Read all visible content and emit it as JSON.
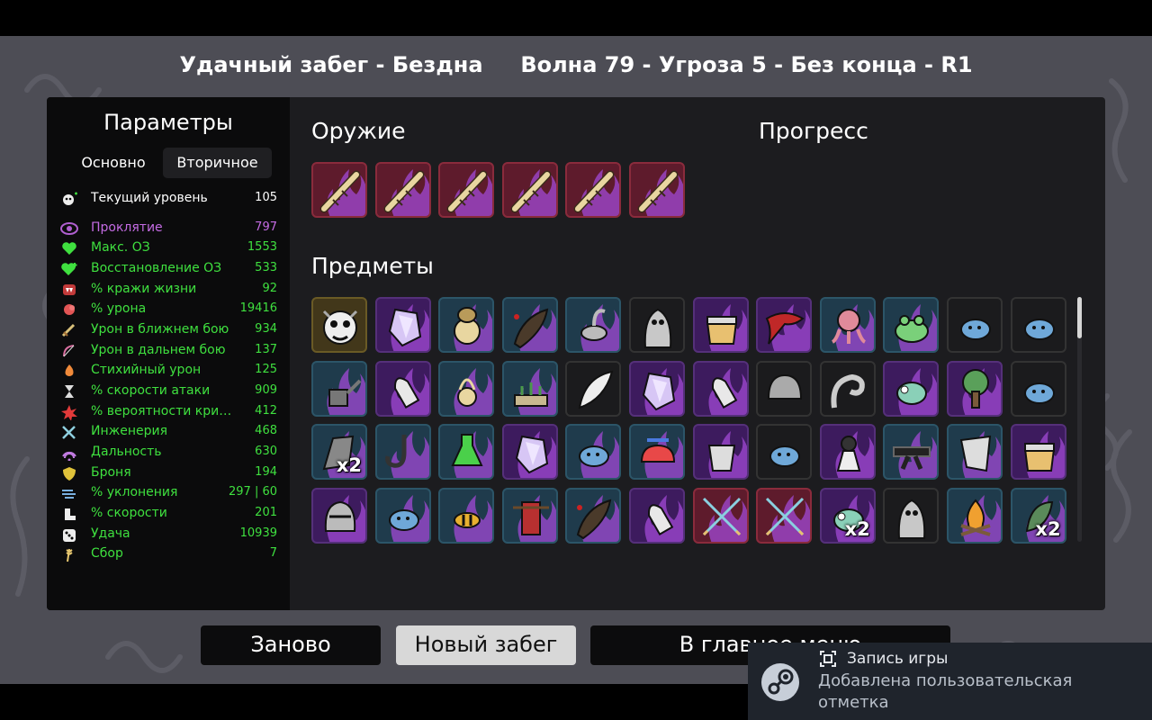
{
  "header": {
    "run_result": "Удачный забег - Бездна",
    "wave_info": "Волна 79 - Угроза 5 - Без конца - R1"
  },
  "params": {
    "title": "Параметры",
    "tabs": [
      "Основно",
      "Вторичное"
    ],
    "active_tab": "Вторичное",
    "stats": [
      {
        "label": "Текущий уровень",
        "value": "105",
        "color": "#ffffff",
        "icon": "level-icon"
      },
      {
        "label": "Проклятие",
        "value": "797",
        "color": "#c46be3",
        "icon": "curse-eye-icon"
      },
      {
        "label": "Макс. ОЗ",
        "value": "1553",
        "color": "#3fe03f",
        "icon": "heart-icon"
      },
      {
        "label": "Восстановление ОЗ",
        "value": "533",
        "color": "#3fe03f",
        "icon": "heart-regen-icon"
      },
      {
        "label": "% кражи жизни",
        "value": "92",
        "color": "#3fe03f",
        "icon": "lifesteal-fangs-icon"
      },
      {
        "label": "% урона",
        "value": "19416",
        "color": "#3fe03f",
        "icon": "damage-muscle-icon"
      },
      {
        "label": "Урон в ближнем бою",
        "value": "934",
        "color": "#3fe03f",
        "icon": "melee-sword-icon"
      },
      {
        "label": "Урон в дальнем бою",
        "value": "137",
        "color": "#3fe03f",
        "icon": "ranged-bow-icon"
      },
      {
        "label": "Стихийный урон",
        "value": "125",
        "color": "#3fe03f",
        "icon": "elemental-flame-icon"
      },
      {
        "label": "% скорости атаки",
        "value": "909",
        "color": "#3fe03f",
        "icon": "hourglass-icon"
      },
      {
        "label": "% вероятности крит. у...",
        "value": "412",
        "color": "#3fe03f",
        "icon": "crit-burst-icon"
      },
      {
        "label": "Инженерия",
        "value": "468",
        "color": "#3fe03f",
        "icon": "engineering-wrench-icon"
      },
      {
        "label": "Дальность",
        "value": "630",
        "color": "#3fe03f",
        "icon": "range-waves-icon"
      },
      {
        "label": "Броня",
        "value": "194",
        "color": "#3fe03f",
        "icon": "armor-shield-icon"
      },
      {
        "label": "% уклонения",
        "value": "297 | 60",
        "color": "#3fe03f",
        "icon": "dodge-wind-icon"
      },
      {
        "label": "% скорости",
        "value": "201",
        "color": "#3fe03f",
        "icon": "speed-boot-icon"
      },
      {
        "label": "Удача",
        "value": "10939",
        "color": "#3fe03f",
        "icon": "luck-dice-icon"
      },
      {
        "label": "Сбор",
        "value": "7",
        "color": "#3fe03f",
        "icon": "harvest-wheat-icon"
      }
    ]
  },
  "weapons": {
    "title": "Оружие",
    "items": [
      {
        "icon": "stick-weapon-icon",
        "tier": "legendary"
      },
      {
        "icon": "stick-weapon-icon",
        "tier": "legendary"
      },
      {
        "icon": "stick-weapon-icon",
        "tier": "legendary"
      },
      {
        "icon": "stick-weapon-icon",
        "tier": "legendary"
      },
      {
        "icon": "stick-weapon-icon",
        "tier": "legendary"
      },
      {
        "icon": "stick-weapon-icon",
        "tier": "legendary"
      }
    ]
  },
  "progress": {
    "title": "Прогресс"
  },
  "items": {
    "title": "Предметы",
    "list": [
      {
        "icon": "skull-mask-icon",
        "tier": "special",
        "count": ""
      },
      {
        "icon": "crystal-icon",
        "tier": "rare",
        "count": ""
      },
      {
        "icon": "compact-mirror-icon",
        "tier": "uncommon",
        "count": ""
      },
      {
        "icon": "leech-icon",
        "tier": "uncommon",
        "count": ""
      },
      {
        "icon": "scorpion-icon",
        "tier": "uncommon",
        "count": ""
      },
      {
        "icon": "ghost-statue-icon",
        "tier": "common",
        "count": ""
      },
      {
        "icon": "honey-jar-icon",
        "tier": "rare",
        "count": ""
      },
      {
        "icon": "red-scarf-icon",
        "tier": "rare",
        "count": ""
      },
      {
        "icon": "octopus-icon",
        "tier": "uncommon",
        "count": ""
      },
      {
        "icon": "frog-icon",
        "tier": "uncommon",
        "count": ""
      },
      {
        "icon": "blue-fish-icon",
        "tier": "common",
        "count": ""
      },
      {
        "icon": "blue-fish-icon",
        "tier": "common",
        "count": ""
      },
      {
        "icon": "watering-can-icon",
        "tier": "uncommon",
        "count": ""
      },
      {
        "icon": "bullet-icon",
        "tier": "rare",
        "count": ""
      },
      {
        "icon": "locket-icon",
        "tier": "uncommon",
        "count": ""
      },
      {
        "icon": "garden-bed-icon",
        "tier": "uncommon",
        "count": ""
      },
      {
        "icon": "feather-icon",
        "tier": "common",
        "count": ""
      },
      {
        "icon": "crystal-icon",
        "tier": "rare",
        "count": ""
      },
      {
        "icon": "bullet-icon",
        "tier": "rare",
        "count": ""
      },
      {
        "icon": "helmet-icon",
        "tier": "common",
        "count": ""
      },
      {
        "icon": "tentacle-icon",
        "tier": "common",
        "count": ""
      },
      {
        "icon": "chameleon-icon",
        "tier": "rare",
        "count": ""
      },
      {
        "icon": "tree-icon",
        "tier": "rare",
        "count": ""
      },
      {
        "icon": "blue-fish-icon",
        "tier": "common",
        "count": ""
      },
      {
        "icon": "stone-idol-icon",
        "tier": "uncommon",
        "count": "x2"
      },
      {
        "icon": "hook-icon",
        "tier": "uncommon",
        "count": ""
      },
      {
        "icon": "green-potion-icon",
        "tier": "uncommon",
        "count": ""
      },
      {
        "icon": "crystal-icon",
        "tier": "rare",
        "count": ""
      },
      {
        "icon": "blue-fish-icon",
        "tier": "uncommon",
        "count": ""
      },
      {
        "icon": "propeller-hat-icon",
        "tier": "uncommon",
        "count": ""
      },
      {
        "icon": "bucket-icon",
        "tier": "rare",
        "count": ""
      },
      {
        "icon": "blue-fish-icon",
        "tier": "common",
        "count": ""
      },
      {
        "icon": "maid-doll-icon",
        "tier": "rare",
        "count": ""
      },
      {
        "icon": "black-belt-icon",
        "tier": "uncommon",
        "count": ""
      },
      {
        "icon": "gauntlet-icon",
        "tier": "uncommon",
        "count": ""
      },
      {
        "icon": "honey-jar-icon",
        "tier": "rare",
        "count": ""
      },
      {
        "icon": "knight-helm-icon",
        "tier": "rare",
        "count": ""
      },
      {
        "icon": "blue-fish-icon",
        "tier": "uncommon",
        "count": ""
      },
      {
        "icon": "wasp-icon",
        "tier": "uncommon",
        "count": ""
      },
      {
        "icon": "scarecrow-icon",
        "tier": "uncommon",
        "count": ""
      },
      {
        "icon": "leech-icon",
        "tier": "uncommon",
        "count": ""
      },
      {
        "icon": "bullet-icon",
        "tier": "rare",
        "count": ""
      },
      {
        "icon": "crossed-arrows-icon",
        "tier": "legendary",
        "count": ""
      },
      {
        "icon": "crossed-arrows-icon",
        "tier": "legendary",
        "count": ""
      },
      {
        "icon": "chameleon-icon",
        "tier": "rare",
        "count": "x2"
      },
      {
        "icon": "ghost-statue-icon",
        "tier": "common",
        "count": ""
      },
      {
        "icon": "campfire-icon",
        "tier": "uncommon",
        "count": ""
      },
      {
        "icon": "green-larva-icon",
        "tier": "uncommon",
        "count": "x2"
      }
    ]
  },
  "buttons": {
    "restart": "Заново",
    "new_run": "Новый забег",
    "main_menu": "В главное меню"
  },
  "toast": {
    "title": "Запись игры",
    "message": "Добавлена пользовательская отметка",
    "icon": "steam-logo-icon"
  },
  "colors": {
    "legendary": "#5e1b2c",
    "rare": "#3d1b5e",
    "uncommon": "#1f3b4c",
    "common": "#1b1b1d",
    "special": "#42371a",
    "stat_green": "#3fe03f",
    "curse_purple": "#c46be3"
  }
}
